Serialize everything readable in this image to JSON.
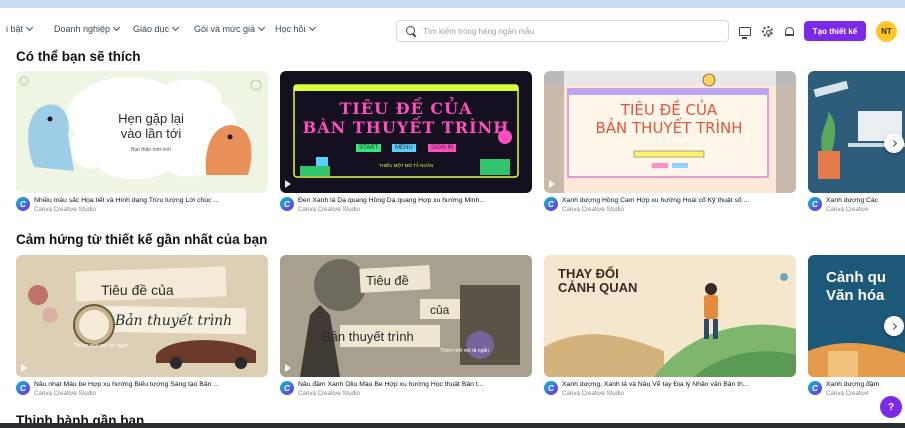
{
  "nav": {
    "items": [
      "i bật",
      "Doanh nghiệp",
      "Giáo dục",
      "Gói và mức giá",
      "Học hỏi"
    ]
  },
  "search": {
    "placeholder": "Tìm kiếm trong hàng ngàn mẫu"
  },
  "header": {
    "icons": [
      "monitor-icon",
      "gear-icon",
      "bell-icon"
    ],
    "create_label": "Tạo thiết kế",
    "avatar_initials": "NT",
    "accent_color": "#7d2ae8",
    "avatar_color": "#ffc628"
  },
  "sections": [
    {
      "title": "Có thể bạn sẽ thích",
      "cards": [
        {
          "name": "Nhiều màu sắc Họa tiết và Hình dạng Trừu tượng Lời chúc ...",
          "author": "Canva Creative Studio",
          "art_lines": [
            "Hẹn gặp lại",
            "vào lần tới",
            "Bạn thân mới mới"
          ]
        },
        {
          "name": "Đen Xanh lá Dạ quang Hồng Dạ quang Hợp xu hướng Minh...",
          "author": "Canva Creative Studio",
          "art_lines": [
            "TIÊU ĐỀ CỦA",
            "BÀN THUYẾT TRÌNH",
            "START",
            "MENU",
            "SIGN IN",
            "THIẾU MỘT MÔ TẢ NGẮN"
          ]
        },
        {
          "name": "Xanh dương Hồng Cam Hợp xu hướng Hoài cổ Kỹ thuật số ...",
          "author": "Canva Creative Studio",
          "art_lines": [
            "TIÊU ĐỀ CỦA",
            "BẢN THUYẾT TRÌNH"
          ]
        },
        {
          "name": "Xanh dương Các",
          "author": "Canva Creative",
          "art_lines": []
        }
      ]
    },
    {
      "title": "Cảm hứng từ thiết kế gần nhất của bạn",
      "cards": [
        {
          "name": "Nâu nhạt Màu be Hợp xu hướng Biểu tượng Sáng tạo Bản ...",
          "author": "Canva Creative Studio",
          "art_lines": [
            "Tiêu đề của",
            "Bản thuyết trình",
            "Thêm một mô tả ngắn"
          ]
        },
        {
          "name": "Nâu đậm Xanh Ôliu Màu Be Hợp xu hướng Học thuật Bản t...",
          "author": "Canva Creative Studio",
          "art_lines": [
            "Tiêu đề",
            "của",
            "Bản thuyết trình",
            "Thêm một mô tả ngắn"
          ]
        },
        {
          "name": "Xanh dương, Xanh lá và Nâu Vẽ tay Địa lý Nhân văn Bản th...",
          "author": "Canva Creative Studio",
          "art_lines": [
            "THAY ĐỔI",
            "CẢNH QUAN"
          ]
        },
        {
          "name": "Xanh dương đậm",
          "author": "Canva Creative",
          "art_lines": [
            "Cảnh qu",
            "Văn hóa"
          ]
        }
      ]
    },
    {
      "title": "Thịnh hành gần bạn"
    }
  ],
  "help_label": "?"
}
